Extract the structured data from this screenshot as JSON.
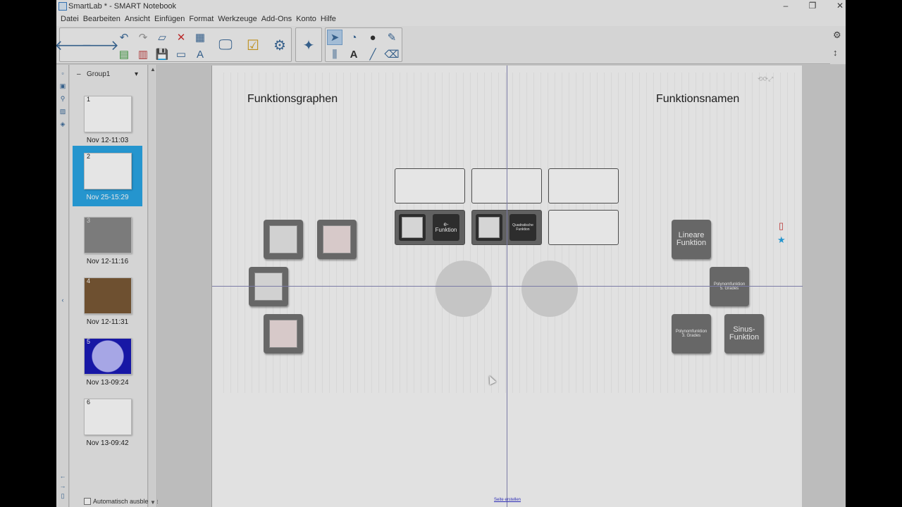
{
  "window": {
    "title": "SmartLab * - SMART Notebook"
  },
  "menu": [
    "Datei",
    "Bearbeiten",
    "Ansicht",
    "Einfügen",
    "Format",
    "Werkzeuge",
    "Add-Ons",
    "Konto",
    "Hilfe"
  ],
  "sorter": {
    "group": "Group1",
    "pages": [
      {
        "num": "1",
        "date": "Nov 12-11:03"
      },
      {
        "num": "2",
        "date": "Nov 25-15:29"
      },
      {
        "num": "3",
        "date": "Nov 12-11:16"
      },
      {
        "num": "4",
        "date": "Nov 12-11:31"
      },
      {
        "num": "5",
        "date": "Nov 13-09:24"
      },
      {
        "num": "6",
        "date": "Nov 13-09:42"
      }
    ],
    "autohide": "Automatisch ausblende"
  },
  "canvas": {
    "left_heading": "Funktionsgraphen",
    "right_heading": "Funktionsnamen",
    "slot_label_1": "e-\nFunktion",
    "slot_label_2": "Quadratische\nFunktion",
    "name_cards": {
      "linear": "Lineare\nFunktion",
      "poly5": "Polynomfunktion\n5. Grades",
      "poly3": "Polynomfunktion\n3. Grades",
      "sinus": "Sinus-\nFunktion"
    },
    "page_added": "Seite erstellen"
  },
  "colors": {
    "accent": "#2aa6e6",
    "page_bg": "#fbfbfb"
  }
}
